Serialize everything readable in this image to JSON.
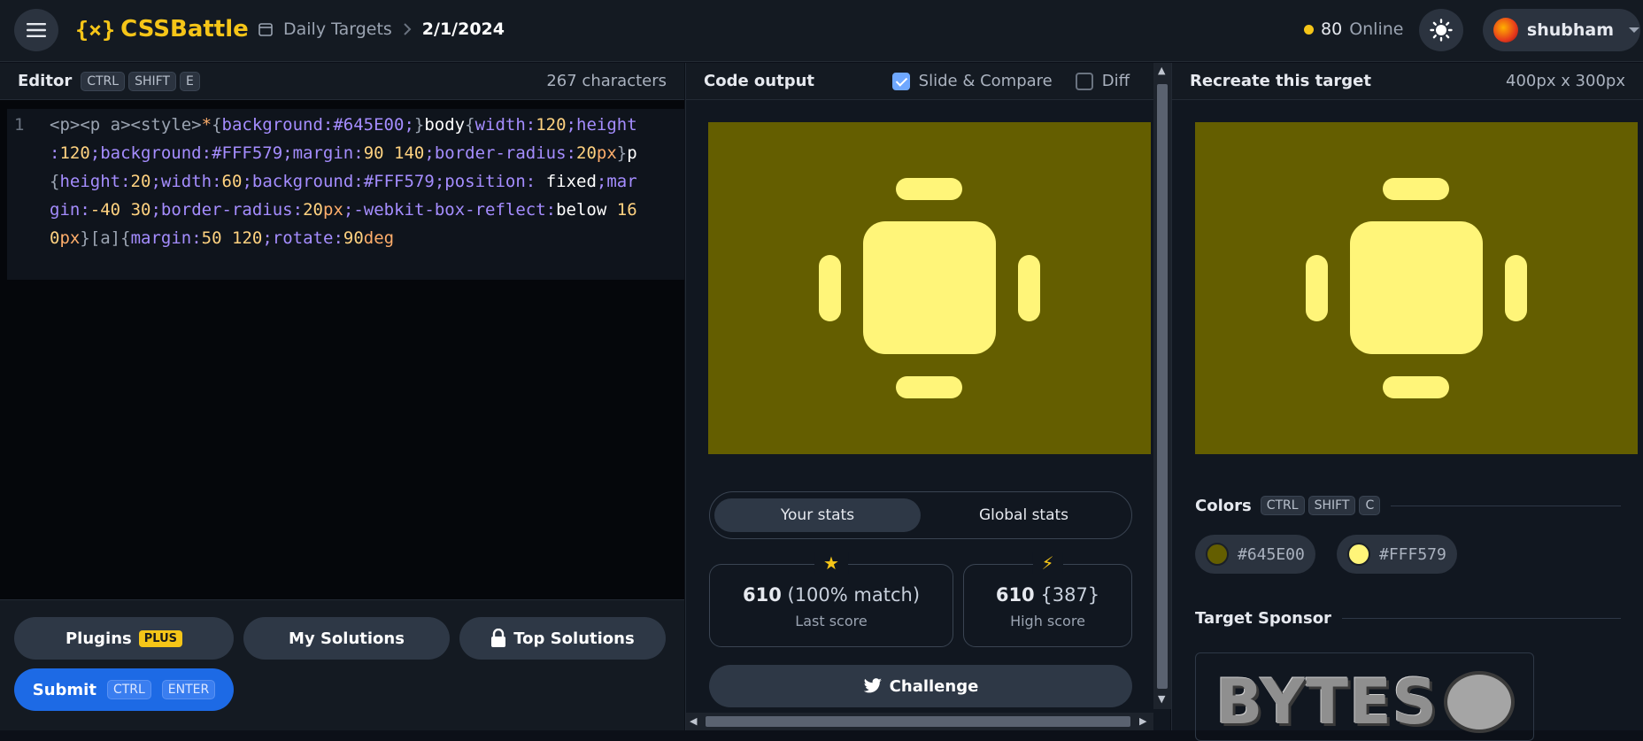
{
  "app": {
    "logo_mark": "{×}",
    "logo_text": "CSSBattle"
  },
  "breadcrumb": {
    "section": "Daily Targets",
    "date": "2/1/2024"
  },
  "online": {
    "count": "80",
    "label": "Online"
  },
  "user": {
    "name": "shubham"
  },
  "editor": {
    "title": "Editor",
    "shortcut": [
      "CTRL",
      "SHIFT",
      "E"
    ],
    "char_count": "267 characters",
    "line_number": "1",
    "code": "<p><p a><style>*{background:#645E00;}body{width:120;height:120;background:#FFF579;margin:90 140;border-radius:20px}p{height:20;width:60;background:#FFF579;position: fixed;margin:-40 30;border-radius:20px;-webkit-box-reflect:below 160px}[a]{margin:50 120;rotate:90deg"
  },
  "buttons": {
    "plugins": "Plugins",
    "plugins_badge": "PLUS",
    "my_solutions": "My Solutions",
    "top_solutions": "Top Solutions",
    "submit": "Submit",
    "submit_keys": [
      "CTRL",
      "ENTER"
    ]
  },
  "output": {
    "title": "Code output",
    "slide_compare": "Slide & Compare",
    "slide_compare_checked": true,
    "diff": "Diff",
    "diff_checked": false,
    "tabs": [
      "Your stats",
      "Global stats"
    ],
    "active_tab": "Your stats",
    "last_score": {
      "score": "610",
      "detail": "(100% match)",
      "label": "Last score"
    },
    "high_score": {
      "score": "610",
      "detail": "{387}",
      "label": "High score"
    },
    "challenge": "Challenge"
  },
  "target": {
    "title": "Recreate this target",
    "size": "400px x 300px",
    "colors_label": "Colors",
    "colors_shortcut": [
      "CTRL",
      "SHIFT",
      "C"
    ],
    "colors": [
      "#645E00",
      "#FFF579"
    ],
    "sponsor_label": "Target Sponsor",
    "sponsor_text": "BYTES"
  },
  "theme": {
    "accent": "#f5c518",
    "primary_button": "#1d6ae5",
    "bg": "#645E00",
    "fg": "#FFF579"
  }
}
